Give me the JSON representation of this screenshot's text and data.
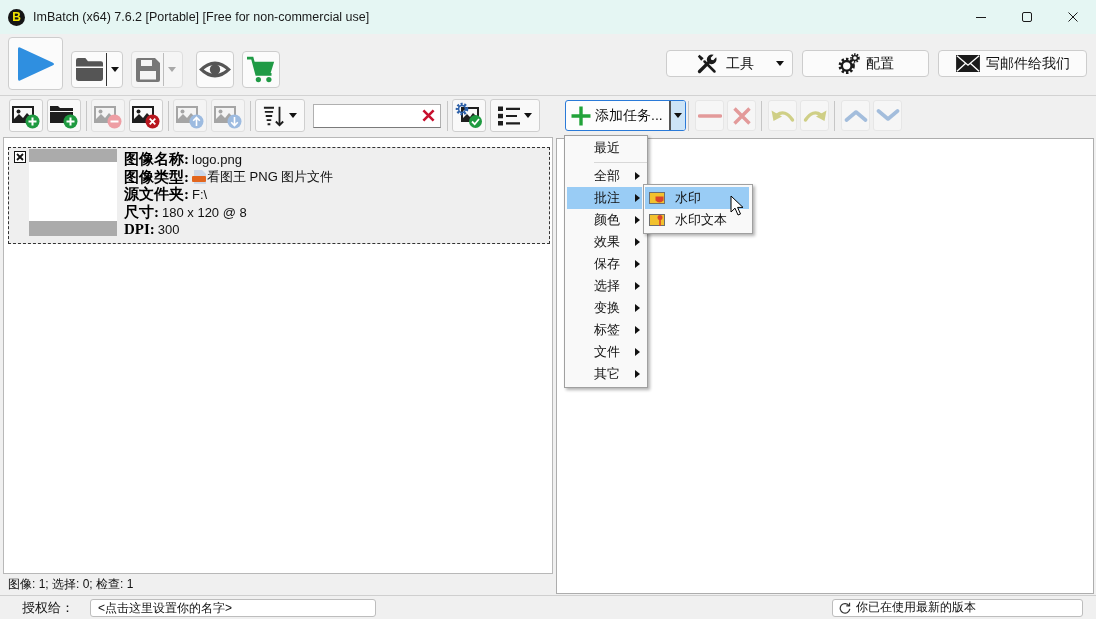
{
  "window": {
    "logo": "B",
    "title": "ImBatch (x64) 7.6.2 [Portable] [Free for non-commercial use]",
    "controls": [
      {
        "kind": "minimize"
      },
      {
        "kind": "maximize"
      },
      {
        "kind": "close"
      }
    ]
  },
  "main_toolbar": {
    "buttons": [
      {
        "kind": "run",
        "disabled": false
      },
      {
        "kind": "open",
        "disabled": false
      },
      {
        "kind": "save",
        "disabled": true
      },
      {
        "kind": "preview",
        "disabled": false
      },
      {
        "kind": "buy",
        "disabled": false
      }
    ],
    "right_buttons": [
      {
        "kind": "tools",
        "label": "工具"
      },
      {
        "kind": "settings",
        "label": "配置"
      },
      {
        "kind": "mail",
        "label": "写邮件给我们"
      }
    ]
  },
  "image_panel": {
    "toolbar": [
      {
        "kind": "add_image",
        "disabled": false
      },
      {
        "kind": "add_folder",
        "disabled": false
      },
      {
        "kind": "separator"
      },
      {
        "kind": "remove_image",
        "disabled": true
      },
      {
        "kind": "clear_images",
        "disabled": false
      },
      {
        "kind": "separator"
      },
      {
        "kind": "move_up",
        "disabled": true
      },
      {
        "kind": "move_down",
        "disabled": true
      },
      {
        "kind": "separator"
      },
      {
        "kind": "sort",
        "disabled": false
      },
      {
        "kind": "search"
      },
      {
        "kind": "separator"
      },
      {
        "kind": "check_settings",
        "disabled": false
      },
      {
        "kind": "view",
        "disabled": false
      }
    ],
    "items": [
      {
        "checked": true,
        "selected": false,
        "fields": [
          {
            "kind": "text",
            "label": "图像名称:",
            "value": "logo.png"
          },
          {
            "kind": "file_type",
            "label": "图像类型:",
            "value": "看图王 PNG 图片文件"
          },
          {
            "kind": "text",
            "label": "源文件夹:",
            "value": "F:\\"
          },
          {
            "kind": "text",
            "label": "尺寸:",
            "value": "180 x 120 @ 8"
          },
          {
            "kind": "text",
            "label": "DPI:",
            "value": "300"
          }
        ]
      }
    ],
    "status": "图像: 1; 选择: 0; 检查: 1"
  },
  "task_panel": {
    "add_button": {
      "label": "添加任务...",
      "expanded": true
    },
    "toolbar": [
      {
        "kind": "separator"
      },
      {
        "kind": "remove",
        "disabled": true
      },
      {
        "kind": "clear",
        "disabled": true
      },
      {
        "kind": "separator"
      },
      {
        "kind": "undo",
        "disabled": true
      },
      {
        "kind": "redo",
        "disabled": true
      },
      {
        "kind": "separator"
      },
      {
        "kind": "move_up",
        "disabled": true
      },
      {
        "kind": "move_down",
        "disabled": true
      }
    ],
    "menu": {
      "items": [
        {
          "kind": "item",
          "label": "最近",
          "has_submenu": false,
          "selected": false
        },
        {
          "kind": "separator"
        },
        {
          "kind": "item",
          "label": "全部",
          "has_submenu": true,
          "selected": false
        },
        {
          "kind": "item",
          "label": "批注",
          "has_submenu": true,
          "selected": true
        },
        {
          "kind": "item",
          "label": "颜色",
          "has_submenu": true,
          "selected": false
        },
        {
          "kind": "item",
          "label": "效果",
          "has_submenu": true,
          "selected": false
        },
        {
          "kind": "item",
          "label": "保存",
          "has_submenu": true,
          "selected": false
        },
        {
          "kind": "item",
          "label": "选择",
          "has_submenu": true,
          "selected": false
        },
        {
          "kind": "item",
          "label": "变换",
          "has_submenu": true,
          "selected": false
        },
        {
          "kind": "item",
          "label": "标签",
          "has_submenu": true,
          "selected": false
        },
        {
          "kind": "item",
          "label": "文件",
          "has_submenu": true,
          "selected": false
        },
        {
          "kind": "item",
          "label": "其它",
          "has_submenu": true,
          "selected": false
        }
      ]
    },
    "submenu": {
      "items": [
        {
          "kind": "watermark",
          "label": "水印",
          "selected": true
        },
        {
          "kind": "watermark_text",
          "label": "水印文本",
          "selected": false
        }
      ]
    }
  },
  "footer": {
    "license_label": "授权给：",
    "license_name": "<点击这里设置你的名字>",
    "update_status": "你已在使用最新的版本"
  }
}
